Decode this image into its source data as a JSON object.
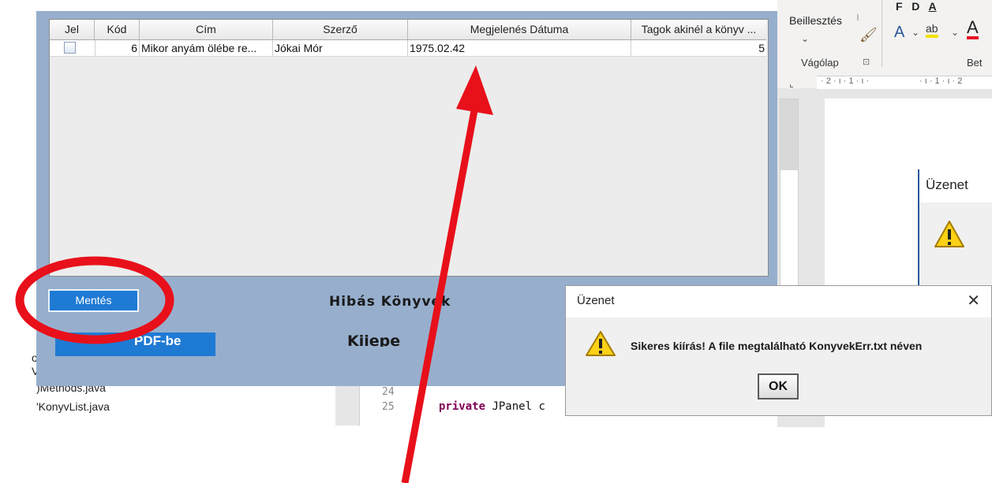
{
  "ide": {
    "files": [
      "o",
      "V",
      ")Methods.java",
      "'KonyvList.java"
    ],
    "line_numbers": [
      "24",
      "25"
    ],
    "code_keyword": "private",
    "code_rest": " JPanel c"
  },
  "word": {
    "ribbon_paste": "Beillesztés",
    "ribbon_clipboard": "Vágólap",
    "ribbon_font_partial": "Bet",
    "ruler_h": "· 2 · ı · 1 · ı ·",
    "ruler_h2": "· ı · 1 · ı · 2",
    "dialog_title": "Üzenet"
  },
  "table": {
    "columns": [
      "Jel",
      "Kód",
      "Cím",
      "Szerző",
      "Megjelenés Dátuma",
      "Tagok akinél a könyv ..."
    ],
    "rows": [
      {
        "kod": "6",
        "cim": "Mikor anyám ölébe re...",
        "szerzo": "Jókai Mór",
        "datum": "1975.02.42",
        "tagok": "5"
      }
    ]
  },
  "app": {
    "save_button": "Mentés",
    "pdf_button": "PDF-be",
    "label_hibas": "Hibás Könyvek",
    "label_kiir": "Kiiepe"
  },
  "dialog": {
    "title": "Üzenet",
    "message": "Sikeres kiírás! A file megtalálható KonyvekErr.txt néven",
    "ok": "OK",
    "close": "✕",
    "icon": "warning-icon"
  },
  "annotation_color": "#e8101a"
}
